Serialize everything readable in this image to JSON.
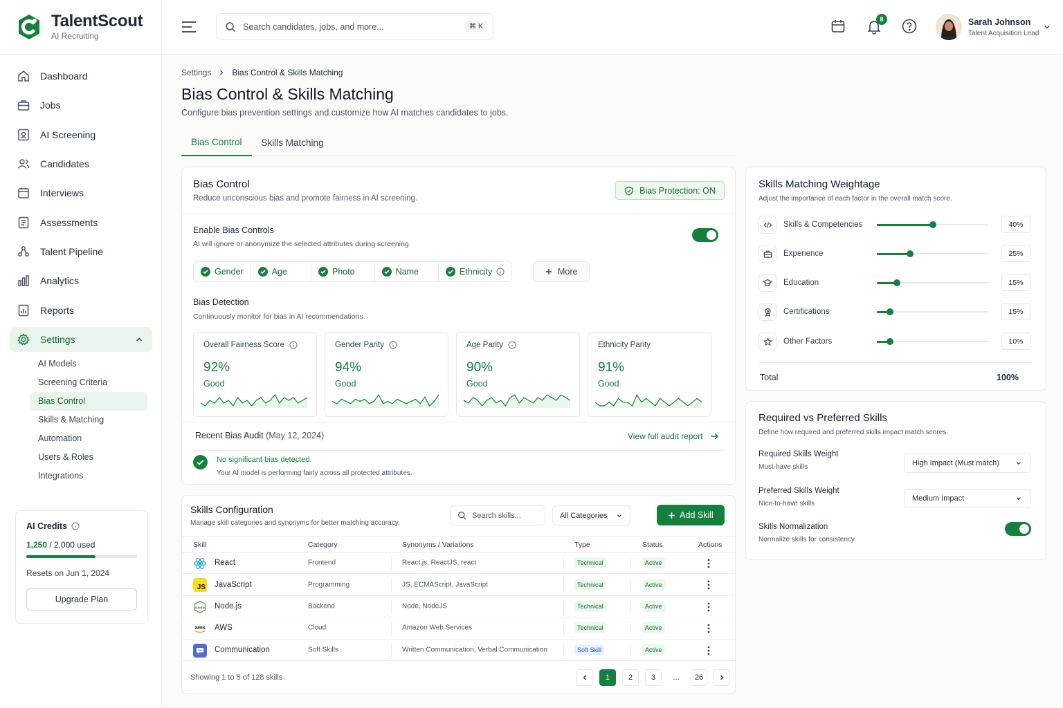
{
  "app": {
    "name": "TalentScout",
    "tagline": "AI Recruiting"
  },
  "sidebar": {
    "items": [
      {
        "label": "Dashboard",
        "icon": "home-icon"
      },
      {
        "label": "Jobs",
        "icon": "briefcase-icon"
      },
      {
        "label": "AI Screening",
        "icon": "screening-icon"
      },
      {
        "label": "Candidates",
        "icon": "users-icon"
      },
      {
        "label": "Interviews",
        "icon": "calendar-icon"
      },
      {
        "label": "Assessments",
        "icon": "document-icon"
      },
      {
        "label": "Talent Pipeline",
        "icon": "pipeline-icon"
      },
      {
        "label": "Analytics",
        "icon": "bar-chart-icon"
      },
      {
        "label": "Reports",
        "icon": "report-icon"
      },
      {
        "label": "Settings",
        "icon": "gear-icon"
      }
    ],
    "settings_sub": [
      "AI Models",
      "Screening Criteria",
      "Bias Control",
      "Skills & Matching",
      "Automation",
      "Users & Roles",
      "Integrations"
    ],
    "credits": {
      "title": "AI Credits",
      "used": "1,250",
      "total": "/ 2,000 used",
      "fraction": 0.625,
      "reset": "Resets on Jun 1, 2024",
      "upgrade": "Upgrade Plan"
    }
  },
  "header": {
    "search_placeholder": "Search candidates, jobs, and more...",
    "shortcut": "⌘ K",
    "notifications": "8",
    "user": {
      "name": "Sarah Johnson",
      "role": "Talent Acquisition Lead"
    }
  },
  "page": {
    "breadcrumb": [
      "Settings",
      "Bias Control & Skills Matching"
    ],
    "title": "Bias Control & Skills Matching",
    "subtitle": "Configure bias prevention settings and customize how AI matches candidates to jobs.",
    "tabs": [
      "Bias Control",
      "Skills Matching"
    ]
  },
  "bias": {
    "title": "Bias Control",
    "subtitle": "Reduce unconscious bias and promote fairness in AI screening.",
    "protection": "Bias Protection: ON",
    "enable_title": "Enable Bias Controls",
    "enable_sub": "AI will ignore or anonymize the selected attributes during screening.",
    "enabled": true,
    "attributes": [
      "Gender",
      "Age",
      "Photo",
      "Name",
      "Ethnicity"
    ],
    "more": "More",
    "detection_title": "Bias Detection",
    "detection_sub": "Continuously monitor for bias in AI recommendations.",
    "metrics": [
      {
        "label": "Overall Fairness Score",
        "value": "92%",
        "status": "Good",
        "trend": [
          4,
          3,
          5,
          4,
          6,
          4,
          5,
          3,
          6,
          4,
          5,
          3,
          5,
          6,
          4,
          5,
          7,
          4,
          6,
          5,
          6,
          4,
          5,
          6
        ]
      },
      {
        "label": "Gender Parity",
        "value": "94%",
        "status": "Good",
        "trend": [
          5,
          4,
          6,
          5,
          4,
          6,
          5,
          6,
          4,
          5,
          8,
          4,
          5,
          4,
          6,
          5,
          4,
          5,
          6,
          4,
          7,
          3,
          5,
          8
        ]
      },
      {
        "label": "Age Parity",
        "value": "90%",
        "status": "Good",
        "trend": [
          5,
          4,
          6,
          5,
          3,
          5,
          6,
          4,
          5,
          3,
          6,
          7,
          4,
          6,
          5,
          4,
          6,
          5,
          7,
          6,
          5,
          7,
          6,
          5
        ]
      },
      {
        "label": "Ethnicity Parity",
        "value": "91%",
        "status": "Good",
        "trend": [
          5,
          4,
          4,
          5,
          4,
          6,
          5,
          5,
          4,
          7,
          5,
          6,
          5,
          4,
          6,
          5,
          4,
          5,
          6,
          5,
          4,
          5,
          6,
          5
        ]
      }
    ],
    "audit_title": "Recent Bias Audit",
    "audit_date": "(May 12, 2024)",
    "audit_link": "View full audit report",
    "audit_result": "No significant bias detected.",
    "audit_result_sub": "Your AI model is performing fairly across all protected attributes."
  },
  "skills_config": {
    "title": "Skills Configuration",
    "subtitle": "Manage skill categories and synonyms for better matching accuracy.",
    "search_placeholder": "Search skills...",
    "category_filter": "All Categories",
    "add": "Add Skill",
    "columns": [
      "Skill",
      "Category",
      "Synonyms / Variations",
      "Type",
      "Status",
      "Actions"
    ],
    "rows": [
      {
        "name": "React",
        "category": "Frontend",
        "synonyms": "React.js, ReactJS, react",
        "type": "Technical",
        "status": "Active",
        "icon": "react-icon"
      },
      {
        "name": "JavaScript",
        "category": "Programming",
        "synonyms": "JS, ECMAScript, JavaScript",
        "type": "Technical",
        "status": "Active",
        "icon": "javascript-icon"
      },
      {
        "name": "Node.js",
        "category": "Backend",
        "synonyms": "Node, NodeJS",
        "type": "Technical",
        "status": "Active",
        "icon": "nodejs-icon"
      },
      {
        "name": "AWS",
        "category": "Cloud",
        "synonyms": "Amazon Web Services",
        "type": "Technical",
        "status": "Active",
        "icon": "aws-icon"
      },
      {
        "name": "Communication",
        "category": "Soft Skills",
        "synonyms": "Written Communication, Verbal Communication",
        "type": "Soft Skill",
        "status": "Active",
        "icon": "chat-icon"
      }
    ],
    "footer": "Showing 1 to 5 of 128 skills",
    "pages": [
      "1",
      "2",
      "3",
      "...",
      "26"
    ]
  },
  "weightage": {
    "title": "Skills Matching Weightage",
    "subtitle": "Adjust the importance of each factor in the overall match score.",
    "factors": [
      {
        "label": "Skills & Competencies",
        "pct": "40%",
        "value": 0.5,
        "icon": "code-icon"
      },
      {
        "label": "Experience",
        "pct": "25%",
        "value": 0.3,
        "icon": "briefcase-icon"
      },
      {
        "label": "Education",
        "pct": "15%",
        "value": 0.18,
        "icon": "graduation-cap-icon"
      },
      {
        "label": "Certifications",
        "pct": "15%",
        "value": 0.12,
        "icon": "certificate-icon"
      },
      {
        "label": "Other Factors",
        "pct": "10%",
        "value": 0.12,
        "icon": "star-icon"
      }
    ],
    "total_label": "Total",
    "total": "100%"
  },
  "req_pref": {
    "title": "Required vs Preferred Skills",
    "subtitle": "Define how required and preferred skills impact match scores.",
    "required_label": "Required Skills Weight",
    "required_sub": "Must-have skills",
    "required_value": "High Impact (Must match)",
    "preferred_label": "Preferred Skills Weight",
    "preferred_sub": "Nice-to-have skills",
    "preferred_value": "Medium Impact",
    "normalize_label": "Skills Normalization",
    "normalize_sub": "Normalize skills for consistency",
    "normalize_on": true
  }
}
